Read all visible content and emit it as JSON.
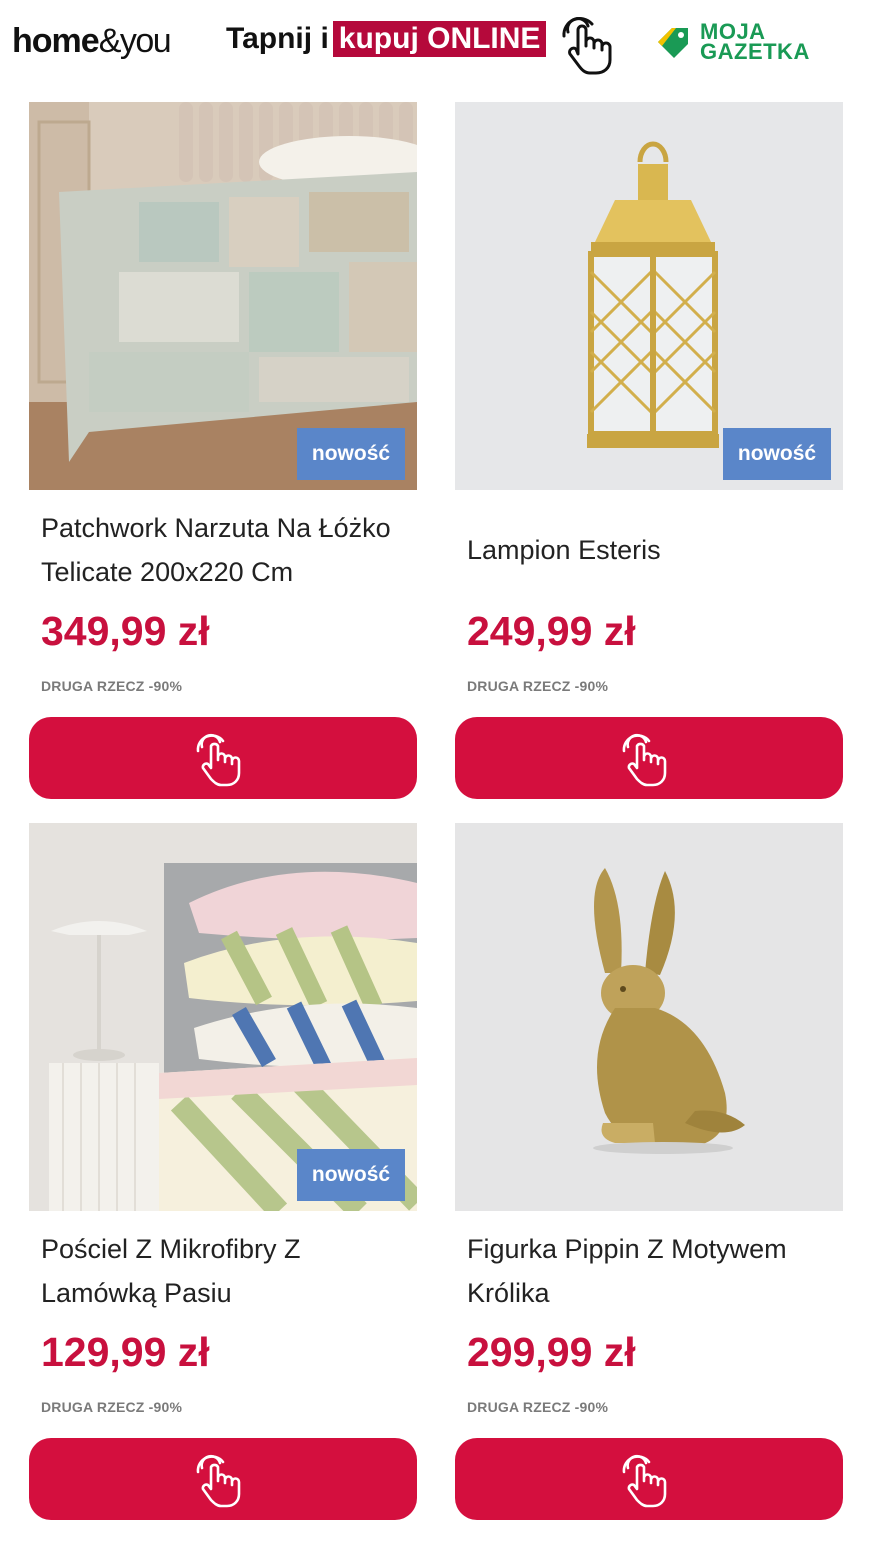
{
  "header": {
    "brand_bold": "home",
    "brand_light": "&you",
    "tagline_plain": "Tapnij i",
    "tagline_highlight": "kupuj ONLINE",
    "partner_line1": "MOJA",
    "partner_line2": "GAZETKA"
  },
  "colors": {
    "accent": "#d40f3e",
    "price": "#c8103e",
    "badge": "#5a86c9",
    "partner_green": "#1a9a55"
  },
  "products": [
    {
      "title": "Patchwork Narzuta Na Łóżko Telicate 200x220 Cm",
      "price": "349,99 zł",
      "promo": "DRUGA RZECZ -90%",
      "badge": "nowość",
      "icon": "tap-hand-icon"
    },
    {
      "title": "Lampion Esteris",
      "price": "249,99 zł",
      "promo": "DRUGA RZECZ -90%",
      "badge": "nowość",
      "icon": "tap-hand-icon"
    },
    {
      "title": "Pościel Z Mikrofibry Z Lamówką Pasiu",
      "price": "129,99 zł",
      "promo": "DRUGA RZECZ -90%",
      "badge": "nowość",
      "icon": "tap-hand-icon"
    },
    {
      "title": "Figurka Pippin Z Motywem Królika",
      "price": "299,99 zł",
      "promo": "DRUGA RZECZ -90%",
      "badge": "",
      "icon": "tap-hand-icon"
    }
  ]
}
